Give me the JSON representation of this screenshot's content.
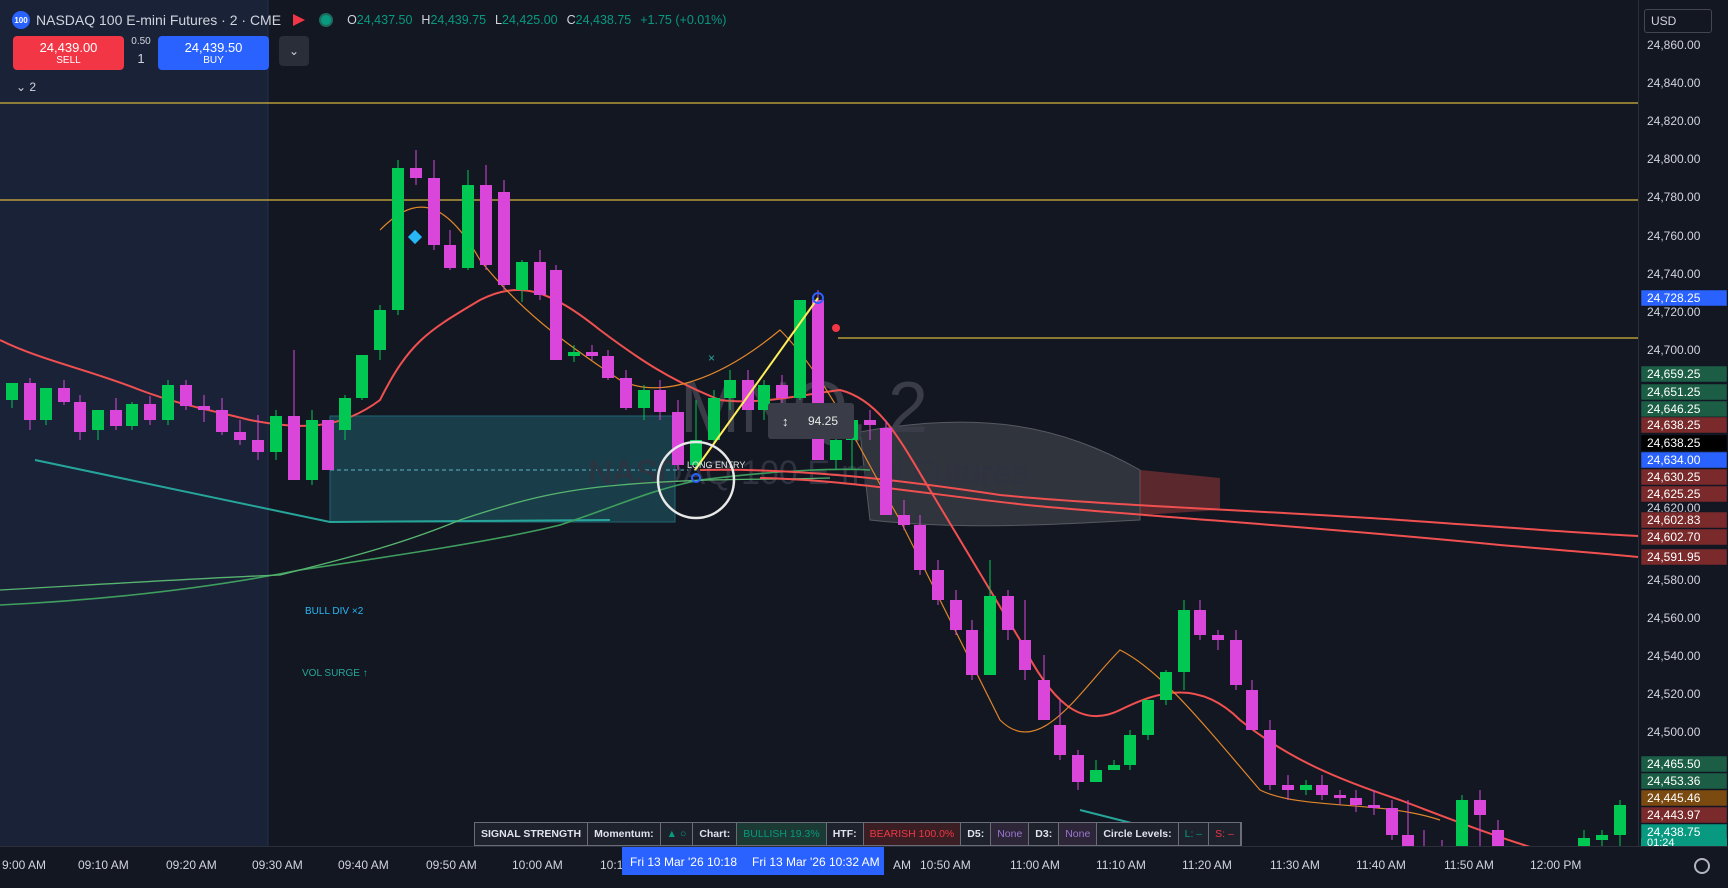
{
  "header": {
    "logo_text": "100",
    "title": "NASDAQ 100 E-mini Futures · 2 · CME",
    "ohlc": [
      {
        "k": "O",
        "v": "24,437.50"
      },
      {
        "k": "H",
        "v": "24,439.75"
      },
      {
        "k": "L",
        "v": "24,425.00"
      },
      {
        "k": "C",
        "v": "24,438.75"
      },
      {
        "k": "",
        "v": "+1.75 (+0.01%)"
      }
    ]
  },
  "trade": {
    "sell_price": "24,439.00",
    "sell_label": "SELL",
    "spread": "0.50",
    "qty": "1",
    "buy_price": "24,439.50",
    "buy_label": "BUY"
  },
  "indicator_toggle": "2",
  "currency": "USD",
  "watermark": {
    "big": "MNQ, 2",
    "small": "NASDAQ 100 E-mini Futures"
  },
  "annotations": {
    "long_entry": "LONG ENTRY",
    "bull_div": "BULL DIV ×2",
    "vol_surge": "VOL SURGE ↑",
    "measure": "94.25"
  },
  "price_axis": {
    "ticks": [
      "24,860.00",
      "24,840.00",
      "24,820.00",
      "24,800.00",
      "24,780.00",
      "24,760.00",
      "24,740.00",
      "24,720.00",
      "24,700.00",
      "24,620.00",
      "24,580.00",
      "24,560.00",
      "24,540.00",
      "24,520.00",
      "24,500.00"
    ],
    "labels": [
      {
        "text": "24,728.25",
        "color": "#2962ff"
      },
      {
        "text": "24,659.25",
        "color": "#1b5e45"
      },
      {
        "text": "24,651.25",
        "color": "#1b5e45"
      },
      {
        "text": "24,646.25",
        "color": "#1b5e45"
      },
      {
        "text": "24,638.25",
        "color": "#7a2a2a"
      },
      {
        "text": "24,638.25",
        "color": "#000000"
      },
      {
        "text": "24,634.00",
        "color": "#2962ff"
      },
      {
        "text": "24,630.25",
        "color": "#7a2a2a"
      },
      {
        "text": "24,625.25",
        "color": "#7a2a2a"
      },
      {
        "text": "24,602.83",
        "color": "#7a2a2a"
      },
      {
        "text": "24,602.70",
        "color": "#7a2a2a"
      },
      {
        "text": "24,591.95",
        "color": "#7a2a2a"
      },
      {
        "text": "24,465.50",
        "color": "#1b5e45"
      },
      {
        "text": "24,453.36",
        "color": "#1b5e45"
      },
      {
        "text": "24,445.46",
        "color": "#7a4a10"
      },
      {
        "text": "24,443.97",
        "color": "#7a2a2a"
      },
      {
        "text": "24,438.75",
        "color": "#089981"
      }
    ],
    "countdown": "01:24"
  },
  "time_axis": {
    "labels": [
      "9:00 AM",
      "09:10 AM",
      "09:20 AM",
      "09:30 AM",
      "09:40 AM",
      "09:50 AM",
      "10:00 AM",
      "10:1",
      "AM",
      "10:50 AM",
      "11:00 AM",
      "11:10 AM",
      "11:20 AM",
      "11:30 AM",
      "11:40 AM",
      "11:50 AM",
      "12:00 PM"
    ],
    "crosshair_labels": [
      "Fri 13 Mar '26   10:18",
      "Fri 13 Mar '26   10:32 AM"
    ]
  },
  "signal_panel": {
    "title": "SIGNAL STRENGTH",
    "momentum_label": "Momentum:",
    "momentum_value": "▲ ○",
    "chart_label": "Chart:",
    "chart_value": "BULLISH 19.3%",
    "htf_label": "HTF:",
    "htf_value": "BEARISH 100.0%",
    "d5_label": "D5:",
    "d5_value": "None",
    "d3_label": "D3:",
    "d3_value": "None",
    "circle_label": "Circle Levels:",
    "circle_l": "L: –",
    "circle_s": "S: –"
  },
  "colors": {
    "up": "#00c853",
    "down": "#d946d9",
    "bg": "#131722",
    "level": "#d4b43c",
    "ema": "#f05050"
  }
}
